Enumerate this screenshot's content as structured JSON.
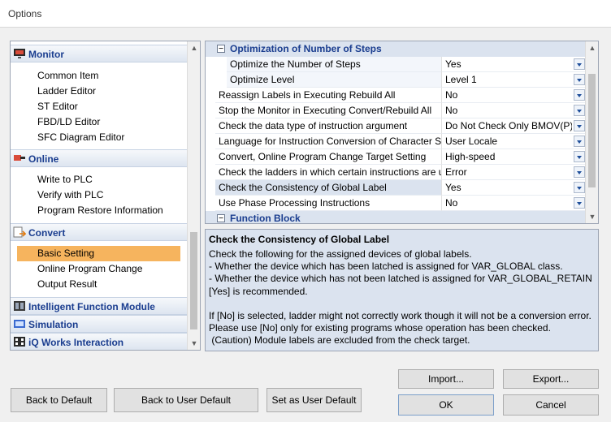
{
  "window": {
    "title": "Options"
  },
  "nav": {
    "categories": [
      {
        "label": "Monitor",
        "items": [
          "Common Item",
          "Ladder Editor",
          "ST Editor",
          "FBD/LD Editor",
          "SFC Diagram Editor"
        ]
      },
      {
        "label": "Online",
        "items": [
          "Write to PLC",
          "Verify with PLC",
          "Program Restore Information"
        ]
      },
      {
        "label": "Convert",
        "items": [
          "Basic Setting",
          "Online Program Change",
          "Output Result"
        ]
      },
      {
        "label": "Intelligent Function Module"
      },
      {
        "label": "Simulation"
      },
      {
        "label": "iQ Works Interaction"
      }
    ],
    "selected": "Basic Setting"
  },
  "grid": {
    "section_optimization": "Optimization of Number of Steps",
    "section_function_block": "Function Block",
    "rows": [
      {
        "name": "Optimize the Number of Steps",
        "value": "Yes"
      },
      {
        "name": "Optimize Level",
        "value": "Level 1"
      },
      {
        "name": "Reassign Labels in Executing Rebuild All",
        "value": "No"
      },
      {
        "name": "Stop the Monitor in Executing Convert/Rebuild All",
        "value": "No"
      },
      {
        "name": "Check the data type of instruction argument",
        "value": "Do Not Check Only BMOV(P),FMOV(P)"
      },
      {
        "name": "Language for Instruction Conversion of Character String",
        "value": "User Locale"
      },
      {
        "name": "Convert, Online Program Change Target Setting",
        "value": "High-speed"
      },
      {
        "name": "Check the ladders in which certain instructions are used",
        "value": "Error"
      },
      {
        "name": "Check the Consistency of Global Label",
        "value": "Yes"
      },
      {
        "name": "Use Phase Processing Instructions",
        "value": "No"
      }
    ]
  },
  "description": {
    "title": "Check the Consistency of Global Label",
    "body": "Check the following for the assigned devices of global labels.\n- Whether the device which has been latched is assigned for VAR_GLOBAL class.\n- Whether the device which has not been latched is assigned for VAR_GLOBAL_RETAIN\n[Yes] is recommended.\n\nIf [No] is selected, ladder might not correctly work though it will not be a conversion error.\nPlease use [No] only for existing programs whose operation has been checked.\n (Caution) Module labels are excluded from the check target."
  },
  "buttons": {
    "back_to_default": "Back to Default",
    "back_to_user_default": "Back to User Default",
    "set_as_user_default": "Set as User Default",
    "import": "Import...",
    "export": "Export...",
    "ok": "OK",
    "cancel": "Cancel"
  }
}
